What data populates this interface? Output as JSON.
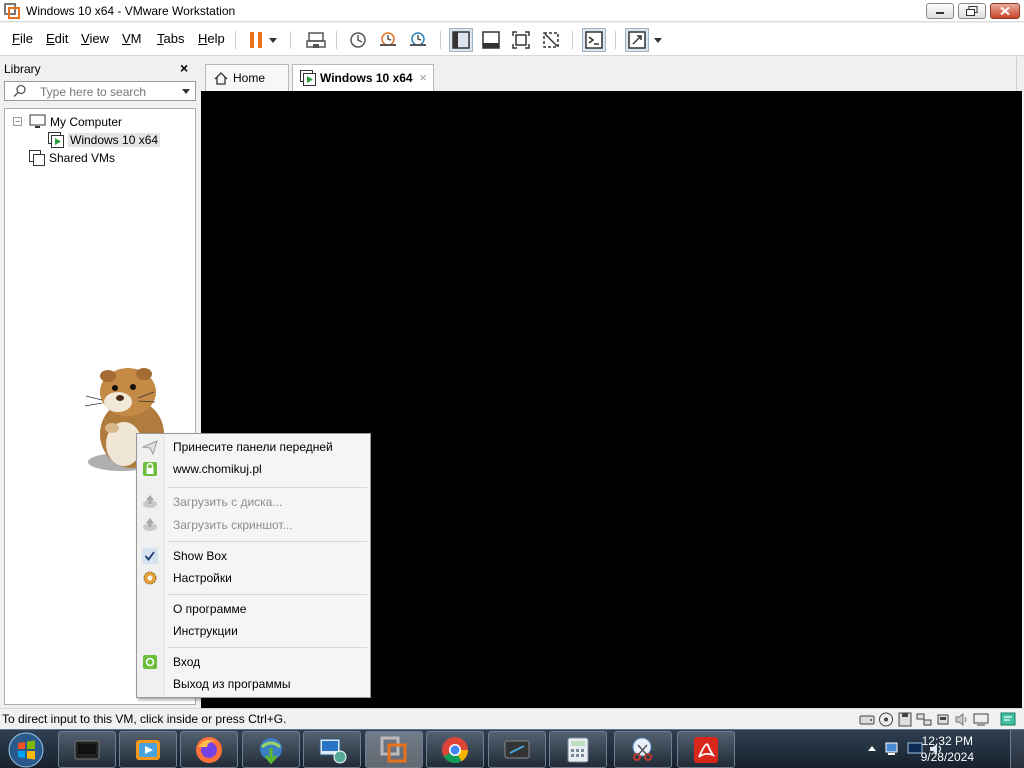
{
  "window": {
    "title": "Windows 10 x64 - VMware Workstation"
  },
  "menubar": {
    "items": [
      {
        "label": "File",
        "underline": "F",
        "rest": "ile"
      },
      {
        "label": "Edit",
        "underline": "E",
        "rest": "dit"
      },
      {
        "label": "View",
        "underline": "V",
        "rest": "iew"
      },
      {
        "label": "VM",
        "underline": "V",
        "rest": "M"
      },
      {
        "label": "Tabs",
        "underline": "T",
        "rest": "abs"
      },
      {
        "label": "Help",
        "underline": "H",
        "rest": "elp"
      }
    ],
    "toolbar_icons": [
      "pause-icon",
      "dropdown-arrow-icon",
      "send-ctrl-alt-del-icon",
      "snapshot-icon",
      "revert-snapshot-icon",
      "snapshot-manager-icon",
      "library-view-icon",
      "thumbnail-bar-icon",
      "fullscreen-icon",
      "unity-icon",
      "console-icon",
      "stretch-icon"
    ],
    "accent_color": "#e8731c"
  },
  "library": {
    "header": "Library",
    "close_glyph": "×",
    "search_placeholder": "Type here to search",
    "tree": [
      {
        "label": "My Computer",
        "expander": "−",
        "icon": "computer-icon"
      },
      {
        "label": "Windows 10 x64",
        "icon": "vm-running-icon",
        "selected": true
      },
      {
        "label": "Shared VMs",
        "icon": "shared-vms-icon"
      }
    ]
  },
  "tabs": [
    {
      "label": "Home",
      "icon": "home-icon"
    },
    {
      "label": "Windows 10 x64",
      "icon": "vm-running-icon",
      "active": true,
      "close_glyph": "×"
    }
  ],
  "context_menu": {
    "items": [
      {
        "label": "Принесите панели передней",
        "icon": "send-icon",
        "enabled": true
      },
      {
        "label": "www.chomikuj.pl",
        "icon": "lock-icon",
        "enabled": true
      },
      {
        "label": "Загрузить с диска...",
        "icon": "upload-disk-icon",
        "enabled": false
      },
      {
        "label": "Загрузить скриншот...",
        "icon": "upload-screenshot-icon",
        "enabled": false
      },
      {
        "label": "Show Box",
        "icon": "check-icon",
        "enabled": true,
        "checked": true
      },
      {
        "label": "Настройки",
        "icon": "settings-gear-icon",
        "enabled": true
      },
      {
        "label": "О программе",
        "icon": "",
        "enabled": true
      },
      {
        "label": "Инструкции",
        "icon": "",
        "enabled": true
      },
      {
        "label": "Вход",
        "icon": "login-icon",
        "enabled": true
      },
      {
        "label": "Выход из программы",
        "icon": "",
        "enabled": true
      }
    ]
  },
  "statusbar": {
    "text": "To direct input to this VM, click inside or press Ctrl+G.",
    "icons": [
      "hdd-icon",
      "cd-icon",
      "floppy-icon",
      "network-icon",
      "usb-icon",
      "sound-icon",
      "display-icon",
      "message-icon"
    ]
  },
  "taskbar": {
    "apps": [
      "vmware-icon",
      "media-player-icon",
      "firefox-icon",
      "idm-icon",
      "remote-desktop-icon",
      "vmware-workstation-icon",
      "chrome-icon",
      "screen-capture-icon",
      "calculator-icon",
      "snipping-tool-icon",
      "acrobat-icon"
    ],
    "clock_time": "12:32 PM",
    "clock_date": "9/28/2024",
    "tray_icons": [
      "show-hidden-icon",
      "network-tray-icon",
      "display-tray-icon",
      "volume-icon"
    ]
  }
}
